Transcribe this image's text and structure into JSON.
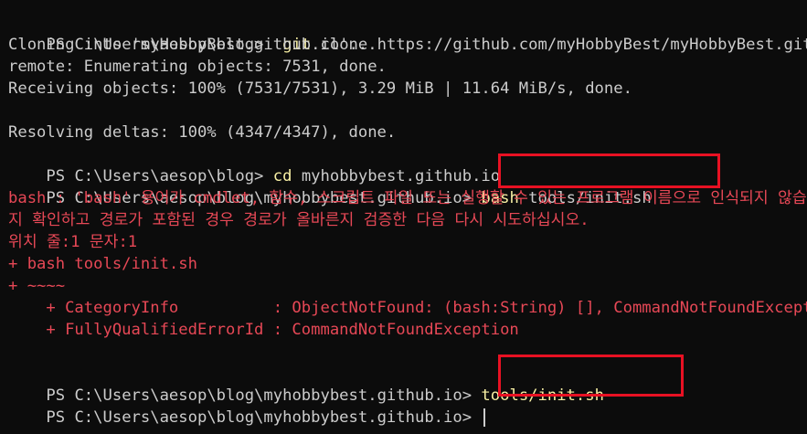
{
  "terminal": {
    "lines": [
      {
        "prompt": "PS C:\\Users\\aesop\\blog>",
        "cmd": "git",
        "args": " clone https://github.com/myHobbyBest/myHobbyBest.github.io"
      },
      {
        "text": "Cloning into 'myHobbyBest.github.io'..."
      },
      {
        "text": "remote: Enumerating objects: 7531, done."
      },
      {
        "text": "Receiving objects: 100% (7531/7531), 3.29 MiB | 11.64 MiB/s, done."
      },
      {
        "text": ""
      },
      {
        "text": "Resolving deltas: 100% (4347/4347), done."
      },
      {
        "prompt": "PS C:\\Users\\aesop\\blog>",
        "cmd": "cd",
        "args": " myhobbybest.github.io"
      },
      {
        "prompt": "PS C:\\Users\\aesop\\blog\\myhobbybest.github.io>",
        "cmd": "bash",
        "args": " tools/init.sh"
      }
    ],
    "error": {
      "line1": "bash : 'bash' 용어가 cmdlet, 함수, 스크립트 파일 또는 실행할 수 있는 프로그램 이름으로 인식되지 않습니다. 이름이 정확한지 확인하고 경로가 포함된 경우 경로가 올바른지 검증한 다음 다시 시도하십시오.",
      "line2": "지 확인하고 경로가 포함된 경우 경로가 올바른지 검증한 다음 다시 시도하십시오.",
      "line3": "위치 줄:1 문자:1",
      "line4": "+ bash tools/init.sh",
      "line5": "+ ~~~~",
      "line6": "    + CategoryInfo          : ObjectNotFound: (bash:String) [], CommandNotFoundException",
      "line7": "    + FullyQualifiedErrorId : CommandNotFoundException"
    },
    "after": [
      {
        "prompt": "PS C:\\Users\\aesop\\blog\\myhobbybest.github.io>",
        "cmd": "tools/init.sh",
        "args": ""
      },
      {
        "prompt": "PS C:\\Users\\aesop\\blog\\myhobbybest.github.io>",
        "cmd": "",
        "args": ""
      }
    ],
    "colors": {
      "background": "#0c0c0c",
      "text": "#cccccc",
      "command": "#f9f1a5",
      "error": "#e74856",
      "highlight_box": "#e81123"
    }
  }
}
